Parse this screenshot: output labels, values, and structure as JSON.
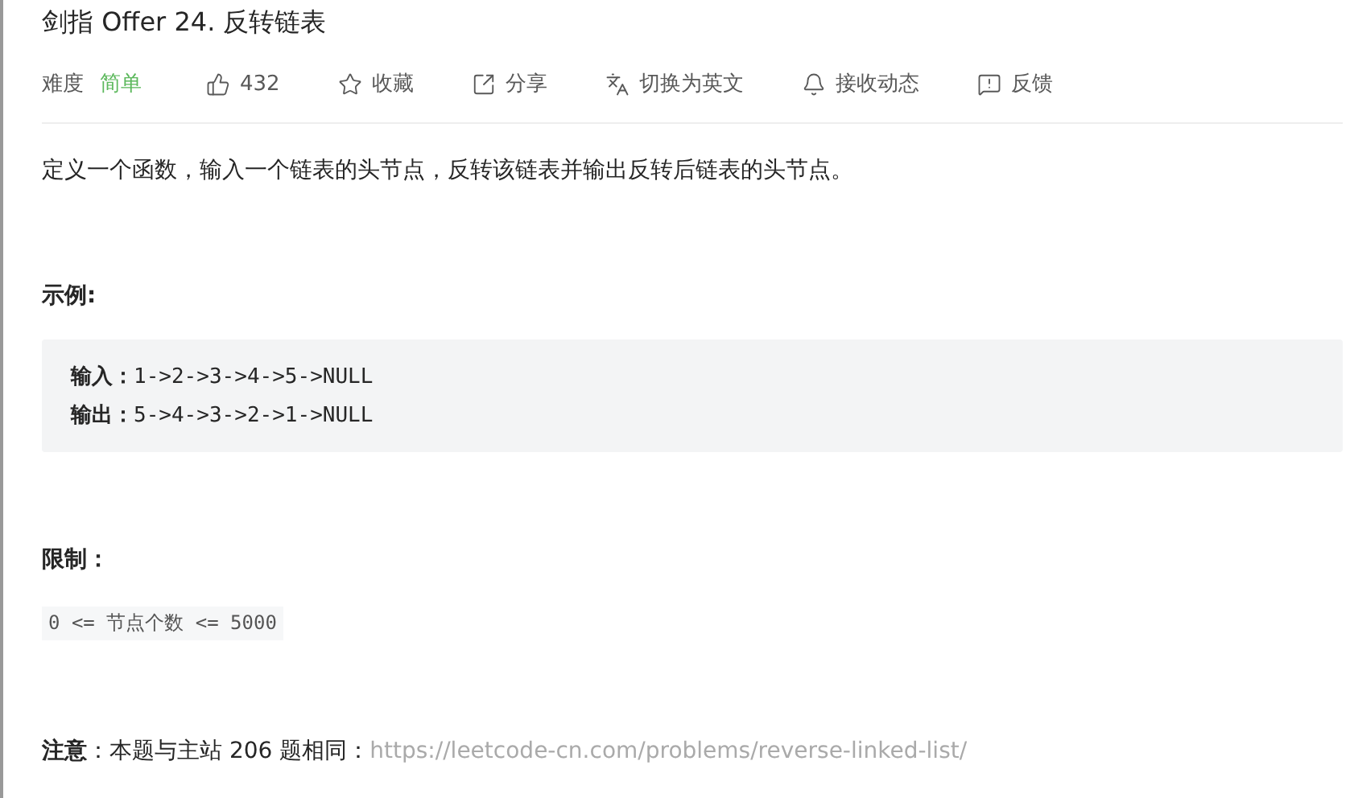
{
  "title": "剑指 Offer 24. 反转链表",
  "meta": {
    "difficulty_label": "难度",
    "difficulty": "简单",
    "actions": [
      {
        "label": "432"
      },
      {
        "label": "收藏"
      },
      {
        "label": "分享"
      },
      {
        "label": "切换为英文"
      },
      {
        "label": "接收动态"
      },
      {
        "label": "反馈"
      }
    ]
  },
  "description": "定义一个函数，输入一个链表的头节点，反转该链表并输出反转后链表的头节点。",
  "example": {
    "heading": "示例:",
    "lines": [
      {
        "label": "输入：",
        "value": "1->2->3->4->5->NULL"
      },
      {
        "label": "输出：",
        "value": "5->4->3->2->1->NULL"
      }
    ]
  },
  "limits": {
    "heading": "限制：",
    "code": "0 <= 节点个数 <= 5000"
  },
  "note": {
    "label": "注意",
    "text": "：本题与主站 206 题相同：",
    "link": "https://leetcode-cn.com/problems/reverse-linked-list/"
  }
}
